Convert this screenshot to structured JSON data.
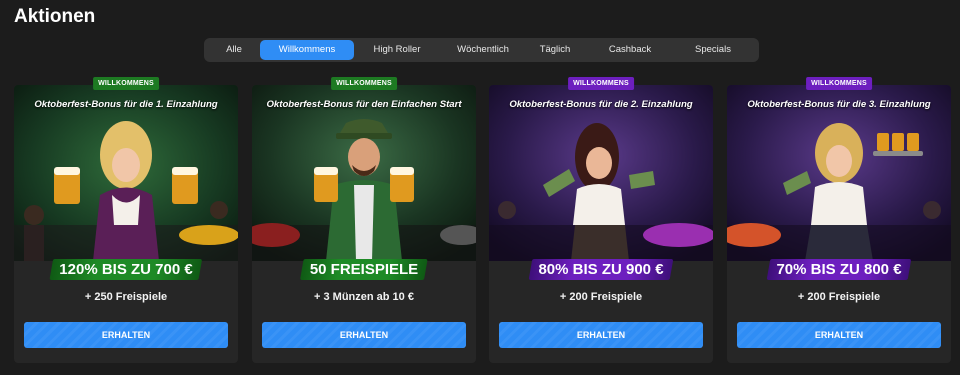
{
  "page": {
    "title": "Aktionen"
  },
  "tabs": [
    {
      "label": "Alle",
      "active": false
    },
    {
      "label": "Willkommens",
      "active": true
    },
    {
      "label": "High Roller",
      "active": false
    },
    {
      "label": "Wöchentlich",
      "active": false
    },
    {
      "label": "Täglich",
      "active": false
    },
    {
      "label": "Cashback",
      "active": false
    },
    {
      "label": "Specials",
      "active": false
    }
  ],
  "colors": {
    "accent": "#2f8df5",
    "green_badge": "#1d7a22",
    "purple_badge": "#6d1fbf",
    "card_bg": "#262626",
    "page_bg": "#1c1c1c"
  },
  "cards": [
    {
      "badge": "WILLKOMMENS",
      "badge_color": "green",
      "title": "Oktoberfest-Bonus für die 1. Einzahlung",
      "amount": "120% BIS ZU 700 €",
      "subtitle": "+ 250 Freispiele",
      "button": "ERHALTEN",
      "art": "blonde-woman-with-beer-mugs"
    },
    {
      "badge": "WILLKOMMENS",
      "badge_color": "green",
      "title": "Oktoberfest-Bonus für den Einfachen Start",
      "amount": "50 FREISPIELE",
      "subtitle": "+ 3 Münzen ab 10 €",
      "button": "ERHALTEN",
      "art": "man-in-green-hat-with-beer-mugs"
    },
    {
      "badge": "WILLKOMMENS",
      "badge_color": "purple",
      "title": "Oktoberfest-Bonus für die 2. Einzahlung",
      "amount": "80% BIS ZU 900 €",
      "subtitle": "+ 200 Freispiele",
      "button": "ERHALTEN",
      "art": "brunette-woman-with-cash"
    },
    {
      "badge": "WILLKOMMENS",
      "badge_color": "purple",
      "title": "Oktoberfest-Bonus für die 3. Einzahlung",
      "amount": "70% BIS ZU 800 €",
      "subtitle": "+ 200 Freispiele",
      "button": "ERHALTEN",
      "art": "blonde-woman-with-beer-tray"
    }
  ]
}
